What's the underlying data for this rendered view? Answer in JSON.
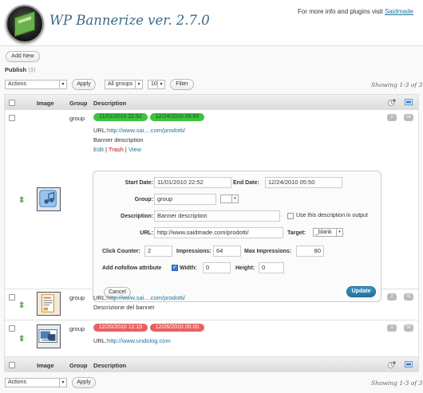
{
  "header": {
    "title": "WP Bannerize ver. 2.7.0",
    "info_text": "For more info and plugins visit",
    "info_link": "Saidmade"
  },
  "add_new": "Add New",
  "publish": {
    "label": "Publish",
    "count": "(3)"
  },
  "toolbar": {
    "actions": "Actions",
    "apply": "Apply",
    "groups": "All groups",
    "per_page": "10",
    "filter": "Filter",
    "showing": "Showing 1-3 of 3"
  },
  "columns": {
    "image": "Image",
    "group": "Group",
    "description": "Description"
  },
  "rows": [
    {
      "group": "group",
      "start": "11/01/2010 22:52",
      "end": "12/24/2010 05:50",
      "url_label": "URL:",
      "url": "http://www.sai....com/prodotti/",
      "description": "Banner description",
      "actions": [
        "Edit",
        "Trash",
        "View"
      ],
      "bubble1": "2",
      "bubble2": "64"
    },
    {
      "group": "group",
      "url_label": "URL:",
      "url": "http://www.sai....com/prodotti/",
      "description": "Descrizione del banner",
      "bubble1": "2",
      "bubble2": "41"
    },
    {
      "group": "group",
      "start": "12/20/2010 12:15",
      "end": "12/26/2010 00:00",
      "url_label": "URL:",
      "url": "http://www.undolog.com",
      "bubble1": "0",
      "bubble2": "56"
    }
  ],
  "edit_form": {
    "start_label": "Start Date:",
    "start_value": "11/01/2010 22:52",
    "end_label": "End Date:",
    "end_value": "12/24/2010 05:50",
    "group_label": "Group:",
    "group_value": "group",
    "description_label": "Description:",
    "description_value": "Banner description",
    "use_desc_label": "Use this description in output",
    "url_label": "URL:",
    "url_value": "http://www.saidmade.com/prodotti/",
    "target_label": "Target:",
    "target_value": "_blank",
    "click_label": "Click Counter:",
    "click_value": "2",
    "impressions_label": "Impressions:",
    "impressions_value": "64",
    "max_label": "Max Impressions:",
    "max_value": "80",
    "nofollow_label": "Add nofollow attribute",
    "width_label": "Width:",
    "width_value": "0",
    "height_label": "Height:",
    "height_value": "0",
    "cancel": "Cancel",
    "update": "Update"
  },
  "colors": {
    "accent": "#21759b",
    "green_pill": "#3fc33f",
    "red_pill": "#e86060",
    "title": "#3a6a8a"
  }
}
